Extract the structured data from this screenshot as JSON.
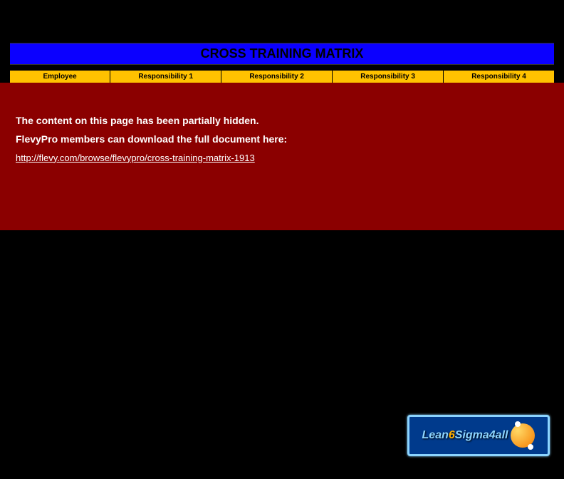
{
  "title": "CROSS TRAINING MATRIX",
  "headers": [
    "Employee",
    "Responsibility 1",
    "Responsibility 2",
    "Responsibility 3",
    "Responsibility 4"
  ],
  "overlay": {
    "line1": "The content on this page has been partially hidden.",
    "line2": "FlevyPro members can download the full document here:",
    "link_text": "http://flevy.com/browse/flevypro/cross-training-matrix-1913"
  },
  "logo": {
    "text_lean": "Lean",
    "text_six": "6",
    "text_sigma": "Sigma4all"
  }
}
